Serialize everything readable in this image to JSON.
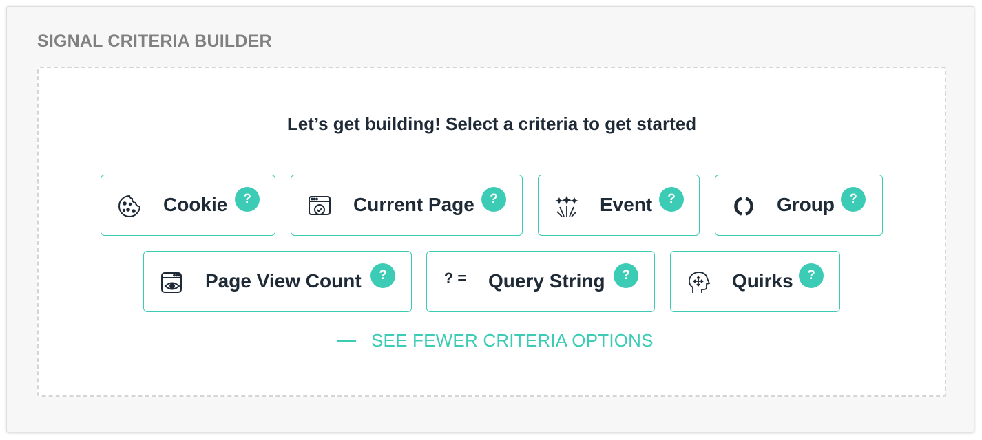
{
  "section_title": "SIGNAL CRITERIA BUILDER",
  "prompt": "Let’s get building! Select a criteria to get started",
  "help_glyph": "?",
  "accent_color": "#3ccbb4",
  "criteria": [
    {
      "label": "Cookie",
      "icon": "cookie-icon"
    },
    {
      "label": "Current Page",
      "icon": "browser-check-icon"
    },
    {
      "label": "Event",
      "icon": "fireworks-icon"
    },
    {
      "label": "Group",
      "icon": "group-ring-icon"
    },
    {
      "label": "Page View Count",
      "icon": "browser-eye-icon"
    },
    {
      "label": "Query String",
      "icon": "query-equals-icon",
      "icon_text": "? ="
    },
    {
      "label": "Quirks",
      "icon": "head-arrows-icon"
    }
  ],
  "toggle_label": "SEE FEWER CRITERIA OPTIONS"
}
